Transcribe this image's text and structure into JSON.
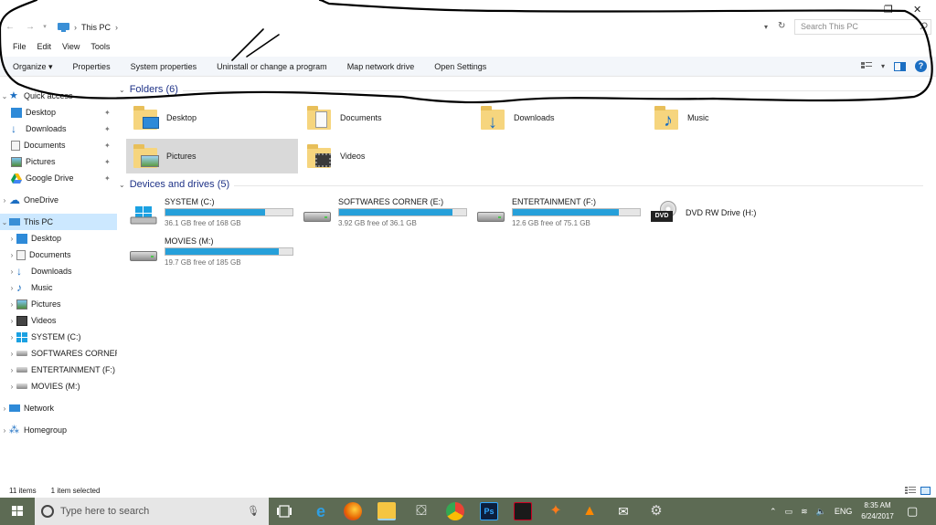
{
  "address": {
    "crumb": "This PC",
    "search_placeholder": "Search This PC"
  },
  "menu": [
    "File",
    "Edit",
    "View",
    "Tools"
  ],
  "commands": [
    "Organize ▾",
    "Properties",
    "System properties",
    "Uninstall or change a program",
    "Map network drive",
    "Open Settings"
  ],
  "nav": {
    "quick_access": "Quick access",
    "quick_items": [
      "Desktop",
      "Downloads",
      "Documents",
      "Pictures",
      "Google Drive"
    ],
    "onedrive": "OneDrive",
    "this_pc": "This PC",
    "pc_items": [
      "Desktop",
      "Documents",
      "Downloads",
      "Music",
      "Pictures",
      "Videos",
      "SYSTEM (C:)",
      "SOFTWARES CORNER",
      "ENTERTAINMENT (F:)",
      "MOVIES (M:)"
    ],
    "network": "Network",
    "homegroup": "Homegroup"
  },
  "folders_header": "Folders (6)",
  "folders": [
    "Desktop",
    "Documents",
    "Downloads",
    "Music",
    "Pictures",
    "Videos"
  ],
  "drives_header": "Devices and drives (5)",
  "drives": [
    {
      "name": "SYSTEM (C:)",
      "free": "36.1 GB free of 168 GB",
      "used_fraction": 0.785
    },
    {
      "name": "SOFTWARES CORNER (E:)",
      "free": "3.92 GB free of 36.1 GB",
      "used_fraction": 0.891
    },
    {
      "name": "ENTERTAINMENT (F:)",
      "free": "12.6 GB free of 75.1 GB",
      "used_fraction": 0.832
    },
    {
      "name": "DVD RW Drive (H:)"
    },
    {
      "name": "MOVIES (M:)",
      "free": "19.7 GB free of 185 GB",
      "used_fraction": 0.894
    }
  ],
  "status": {
    "items": "11 items",
    "selected": "1 item selected"
  },
  "taskbar": {
    "search_placeholder": "Type here to search",
    "lang": "ENG",
    "time": "8:35 AM",
    "date": "6/24/2017"
  },
  "dvd_label": "DVD",
  "ps_label": "Ps"
}
